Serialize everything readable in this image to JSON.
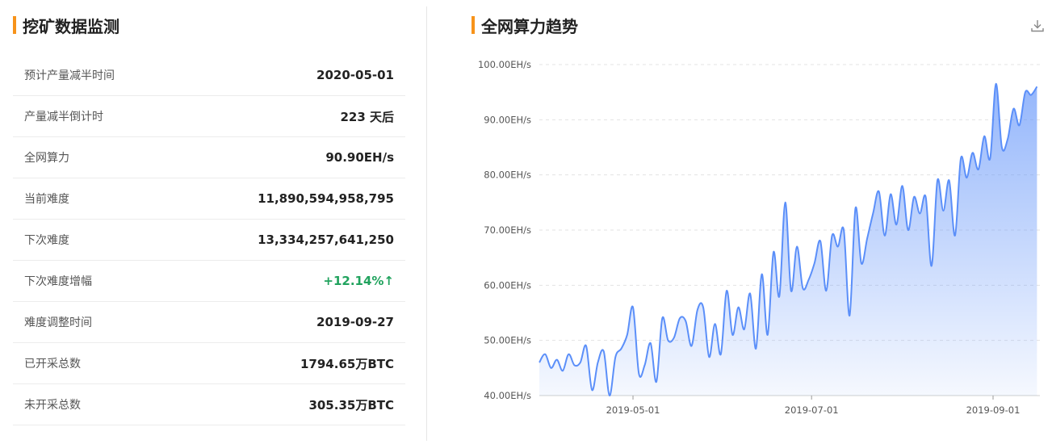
{
  "left_panel": {
    "title": "挖矿数据监测",
    "stats": [
      {
        "label": "预计产量减半时间",
        "value": "2020-05-01"
      },
      {
        "label": "产量减半倒计时",
        "value": "223 天后"
      },
      {
        "label": "全网算力",
        "value": "90.90EH/s"
      },
      {
        "label": "当前难度",
        "value": "11,890,594,958,795"
      },
      {
        "label": "下次难度",
        "value": "13,334,257,641,250"
      },
      {
        "label": "下次难度增幅",
        "value": "+12.14%↑"
      },
      {
        "label": "难度调整时间",
        "value": "2019-09-27"
      },
      {
        "label": "已开采总数",
        "value": "1794.65万BTC"
      },
      {
        "label": "未开采总数",
        "value": "305.35万BTC"
      }
    ]
  },
  "right_panel": {
    "title": "全网算力趋势",
    "download_icon": "download-icon"
  },
  "colors": {
    "accent": "#f7931a",
    "line": "#5b8ff9",
    "positive": "#21a35e"
  },
  "chart_data": {
    "type": "area",
    "xlabel": "",
    "ylabel": "",
    "ylim": [
      40,
      100
    ],
    "y_ticks": [
      "40.00EH/s",
      "50.00EH/s",
      "60.00EH/s",
      "70.00EH/s",
      "80.00EH/s",
      "90.00EH/s",
      "100.00EH/s"
    ],
    "x_ticks": [
      {
        "label": "2019-05-01",
        "date": "2019-05-01"
      },
      {
        "label": "2019-07-01",
        "date": "2019-07-01"
      },
      {
        "label": "2019-09-01",
        "date": "2019-09-01"
      }
    ],
    "xlim": [
      "2019-03-30",
      "2019-09-17"
    ],
    "grid": true,
    "series": [
      {
        "x": [
          "2019-03-30",
          "2019-04-01",
          "2019-04-03",
          "2019-04-05",
          "2019-04-07",
          "2019-04-09",
          "2019-04-11",
          "2019-04-13",
          "2019-04-15",
          "2019-04-17",
          "2019-04-19",
          "2019-04-21",
          "2019-04-23",
          "2019-04-25",
          "2019-04-27",
          "2019-04-29",
          "2019-05-01",
          "2019-05-03",
          "2019-05-05",
          "2019-05-07",
          "2019-05-09",
          "2019-05-11",
          "2019-05-13",
          "2019-05-15",
          "2019-05-17",
          "2019-05-19",
          "2019-05-21",
          "2019-05-23",
          "2019-05-25",
          "2019-05-27",
          "2019-05-29",
          "2019-05-31",
          "2019-06-02",
          "2019-06-04",
          "2019-06-06",
          "2019-06-08",
          "2019-06-10",
          "2019-06-12",
          "2019-06-14",
          "2019-06-16",
          "2019-06-18",
          "2019-06-20",
          "2019-06-22",
          "2019-06-24",
          "2019-06-26",
          "2019-06-28",
          "2019-06-30",
          "2019-07-02",
          "2019-07-04",
          "2019-07-06",
          "2019-07-08",
          "2019-07-10",
          "2019-07-12",
          "2019-07-14",
          "2019-07-16",
          "2019-07-18",
          "2019-07-20",
          "2019-07-22",
          "2019-07-24",
          "2019-07-26",
          "2019-07-28",
          "2019-07-30",
          "2019-08-01",
          "2019-08-03",
          "2019-08-05",
          "2019-08-07",
          "2019-08-09",
          "2019-08-11",
          "2019-08-13",
          "2019-08-15",
          "2019-08-17",
          "2019-08-19",
          "2019-08-21",
          "2019-08-23",
          "2019-08-25",
          "2019-08-27",
          "2019-08-29",
          "2019-08-31",
          "2019-09-02",
          "2019-09-04",
          "2019-09-06",
          "2019-09-08",
          "2019-09-10",
          "2019-09-12",
          "2019-09-14",
          "2019-09-16"
        ],
        "values": [
          46.0,
          47.5,
          45.0,
          46.5,
          44.5,
          47.5,
          45.5,
          46.0,
          49.0,
          41.0,
          46.0,
          48.0,
          40.0,
          47.0,
          48.5,
          51.0,
          56.0,
          44.0,
          45.5,
          49.5,
          42.5,
          54.0,
          50.0,
          50.5,
          54.0,
          53.5,
          49.0,
          55.5,
          56.0,
          47.0,
          53.0,
          47.5,
          59.0,
          51.0,
          56.0,
          52.0,
          58.5,
          48.5,
          62.0,
          51.0,
          66.0,
          58.0,
          75.0,
          59.0,
          67.0,
          59.5,
          61.0,
          64.0,
          68.0,
          59.0,
          69.0,
          67.0,
          70.0,
          54.5,
          74.0,
          64.0,
          68.5,
          73.0,
          77.0,
          69.0,
          76.5,
          71.0,
          78.0,
          70.0,
          76.0,
          73.0,
          76.0,
          63.5,
          79.0,
          73.5,
          79.0,
          69.0,
          83.0,
          79.5,
          84.0,
          81.0,
          87.0,
          83.0,
          96.5,
          85.0,
          86.5,
          92.0,
          89.0,
          95.0,
          94.5,
          96.0
        ]
      }
    ]
  }
}
